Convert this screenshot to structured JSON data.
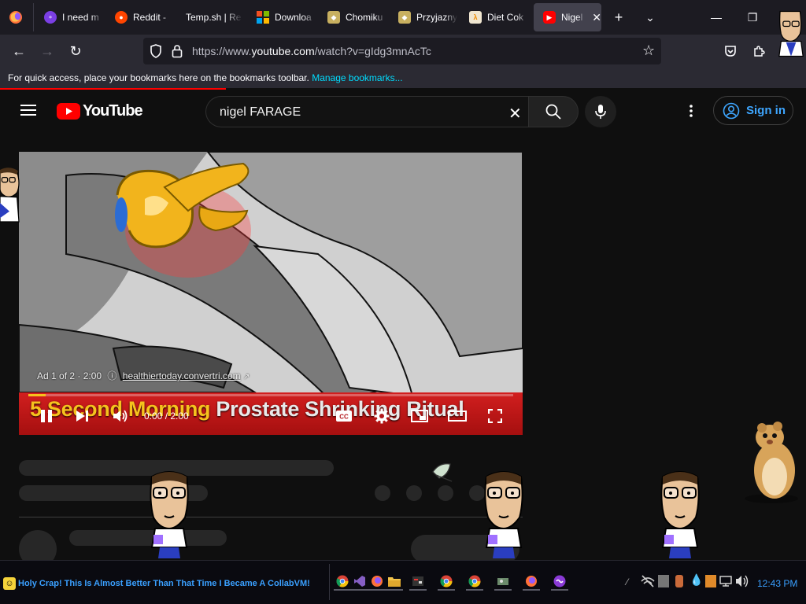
{
  "browser": {
    "tabs": [
      {
        "title": "I need m",
        "favicon": "tor-like-icon",
        "color": "#7b3fe4"
      },
      {
        "title": "Reddit -",
        "favicon": "reddit-icon",
        "color": "#ff4500"
      },
      {
        "title": "Temp.sh | Re",
        "favicon": "",
        "color": ""
      },
      {
        "title": "Downloa",
        "favicon": "windows-icon",
        "color": "#00a4ef"
      },
      {
        "title": "Chomiku",
        "favicon": "chomikuj-icon",
        "color": "#e6b800"
      },
      {
        "title": "Przyjazny",
        "favicon": "chomikuj-icon",
        "color": "#e6b800"
      },
      {
        "title": "Diet Cok",
        "favicon": "half-life-icon",
        "color": "#f08c00"
      },
      {
        "title": "Nigel",
        "favicon": "youtube-icon",
        "color": "#ff0000",
        "active": true
      }
    ],
    "url_prefix": "https://www.",
    "url_domain": "youtube.com",
    "url_path": "/watch?v=gIdg3mnAcTc",
    "bookmarks_prompt": "For quick access, place your bookmarks here on the bookmarks toolbar.",
    "bookmarks_link": "Manage bookmarks..."
  },
  "youtube": {
    "logo_text": "YouTube",
    "search_query": "nigel FARAGE",
    "sign_in": "Sign in",
    "ad_info": "Ad 1 of 2 · 2:00",
    "ad_domain": "healthiertoday.convertri.com",
    "banner_title_part1": "5 Second Morning",
    "banner_title_part2": "Prostate Shrinking Ritual",
    "time_display": "0:00 / 2:00",
    "progress": 0.035,
    "brand_red": "#ff0000",
    "link_blue": "#3ea6ff"
  },
  "taskbar": {
    "window_title": "Holy Crap! This Is Almost Better Than That Time I Became A CollabVM!",
    "clock": "12:43 PM",
    "apps": [
      "chrome-icon",
      "visual-studio-icon",
      "firefox-icon",
      "file-explorer-icon",
      "app-icon",
      "chrome-icon",
      "chrome-icon",
      "app-icon",
      "firefox-icon",
      "app-icon"
    ]
  }
}
